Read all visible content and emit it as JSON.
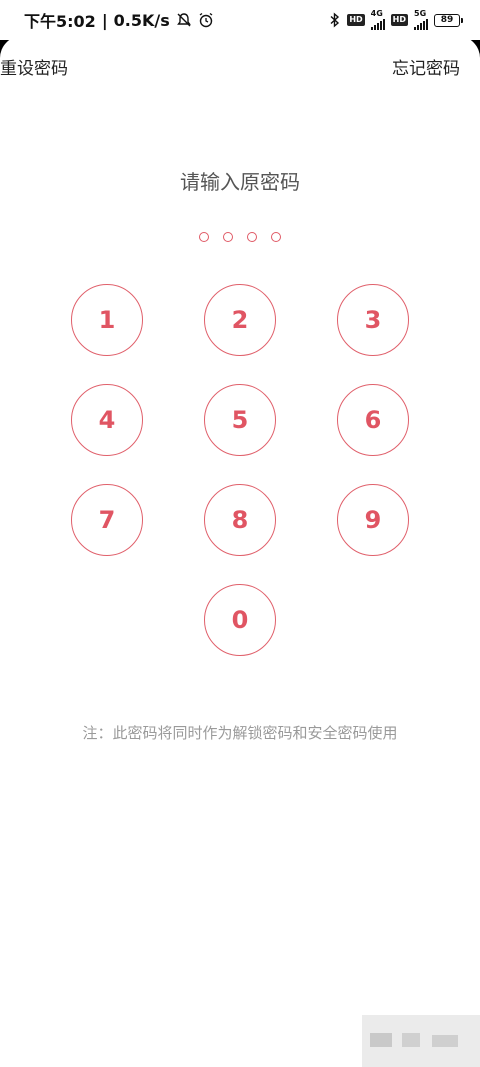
{
  "status_bar": {
    "time": "下午5:02",
    "separator": "|",
    "speed": "0.5K/s",
    "net1": "4G",
    "net2": "5G",
    "hd": "HD",
    "battery": "89"
  },
  "header": {
    "reset_label": "重设密码",
    "forgot_label": "忘记密码"
  },
  "prompt": "请输入原密码",
  "pin_length": 4,
  "keypad": {
    "keys": [
      "1",
      "2",
      "3",
      "4",
      "5",
      "6",
      "7",
      "8",
      "9",
      "0"
    ]
  },
  "note": "注：此密码将同时作为解锁密码和安全密码使用",
  "colors": {
    "accent": "#e05563",
    "text": "#222222",
    "muted": "#9a9a9a"
  }
}
